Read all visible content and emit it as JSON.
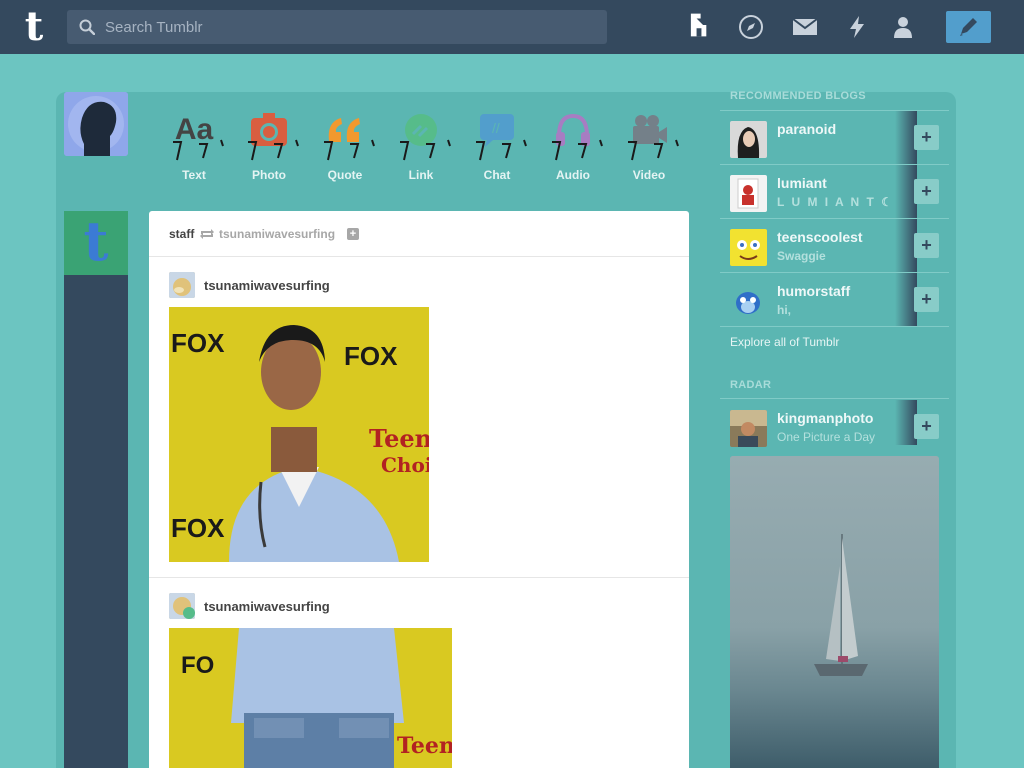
{
  "header": {
    "search_placeholder": "Search Tumblr",
    "logo_letter": "t",
    "colors": {
      "bar": "#34495e",
      "compose": "#529ecc",
      "background": "#6cc5c1"
    }
  },
  "post_types": [
    {
      "label": "Text",
      "icon": "text-icon",
      "glyph": "Aa",
      "color": "#444444"
    },
    {
      "label": "Photo",
      "icon": "camera-icon",
      "color": "#d95e40"
    },
    {
      "label": "Quote",
      "icon": "quote-icon",
      "glyph": "❝",
      "color": "#f2992e"
    },
    {
      "label": "Link",
      "icon": "link-icon",
      "color": "#56bc8a"
    },
    {
      "label": "Chat",
      "icon": "chat-icon",
      "color": "#529ecc"
    },
    {
      "label": "Audio",
      "icon": "headphones-icon",
      "color": "#a77dc2"
    },
    {
      "label": "Video",
      "icon": "video-camera-icon",
      "color": "#748089"
    }
  ],
  "post": {
    "reblogger": "staff",
    "source": "tsunamiwavesurfing",
    "plus": "+",
    "entries": [
      {
        "username": "tsunamiwavesurfing"
      },
      {
        "username": "tsunamiwavesurfing"
      }
    ]
  },
  "sidebar": {
    "recommended_title": "RECOMMENDED BLOGS",
    "blogs": [
      {
        "name": "paranoid",
        "subtitle": "",
        "follow": "+"
      },
      {
        "name": "lumiant",
        "subtitle": "L U M I A N T ☾",
        "follow": "+"
      },
      {
        "name": "teenscoolest",
        "subtitle": "Swaggie",
        "follow": "+"
      },
      {
        "name": "humorstaff",
        "subtitle": "hi,",
        "follow": "+"
      }
    ],
    "explore_label": "Explore all of Tumblr",
    "radar_title": "RADAR",
    "radar": {
      "name": "kingmanphoto",
      "subtitle": "One Picture a Day",
      "follow": "+"
    }
  }
}
